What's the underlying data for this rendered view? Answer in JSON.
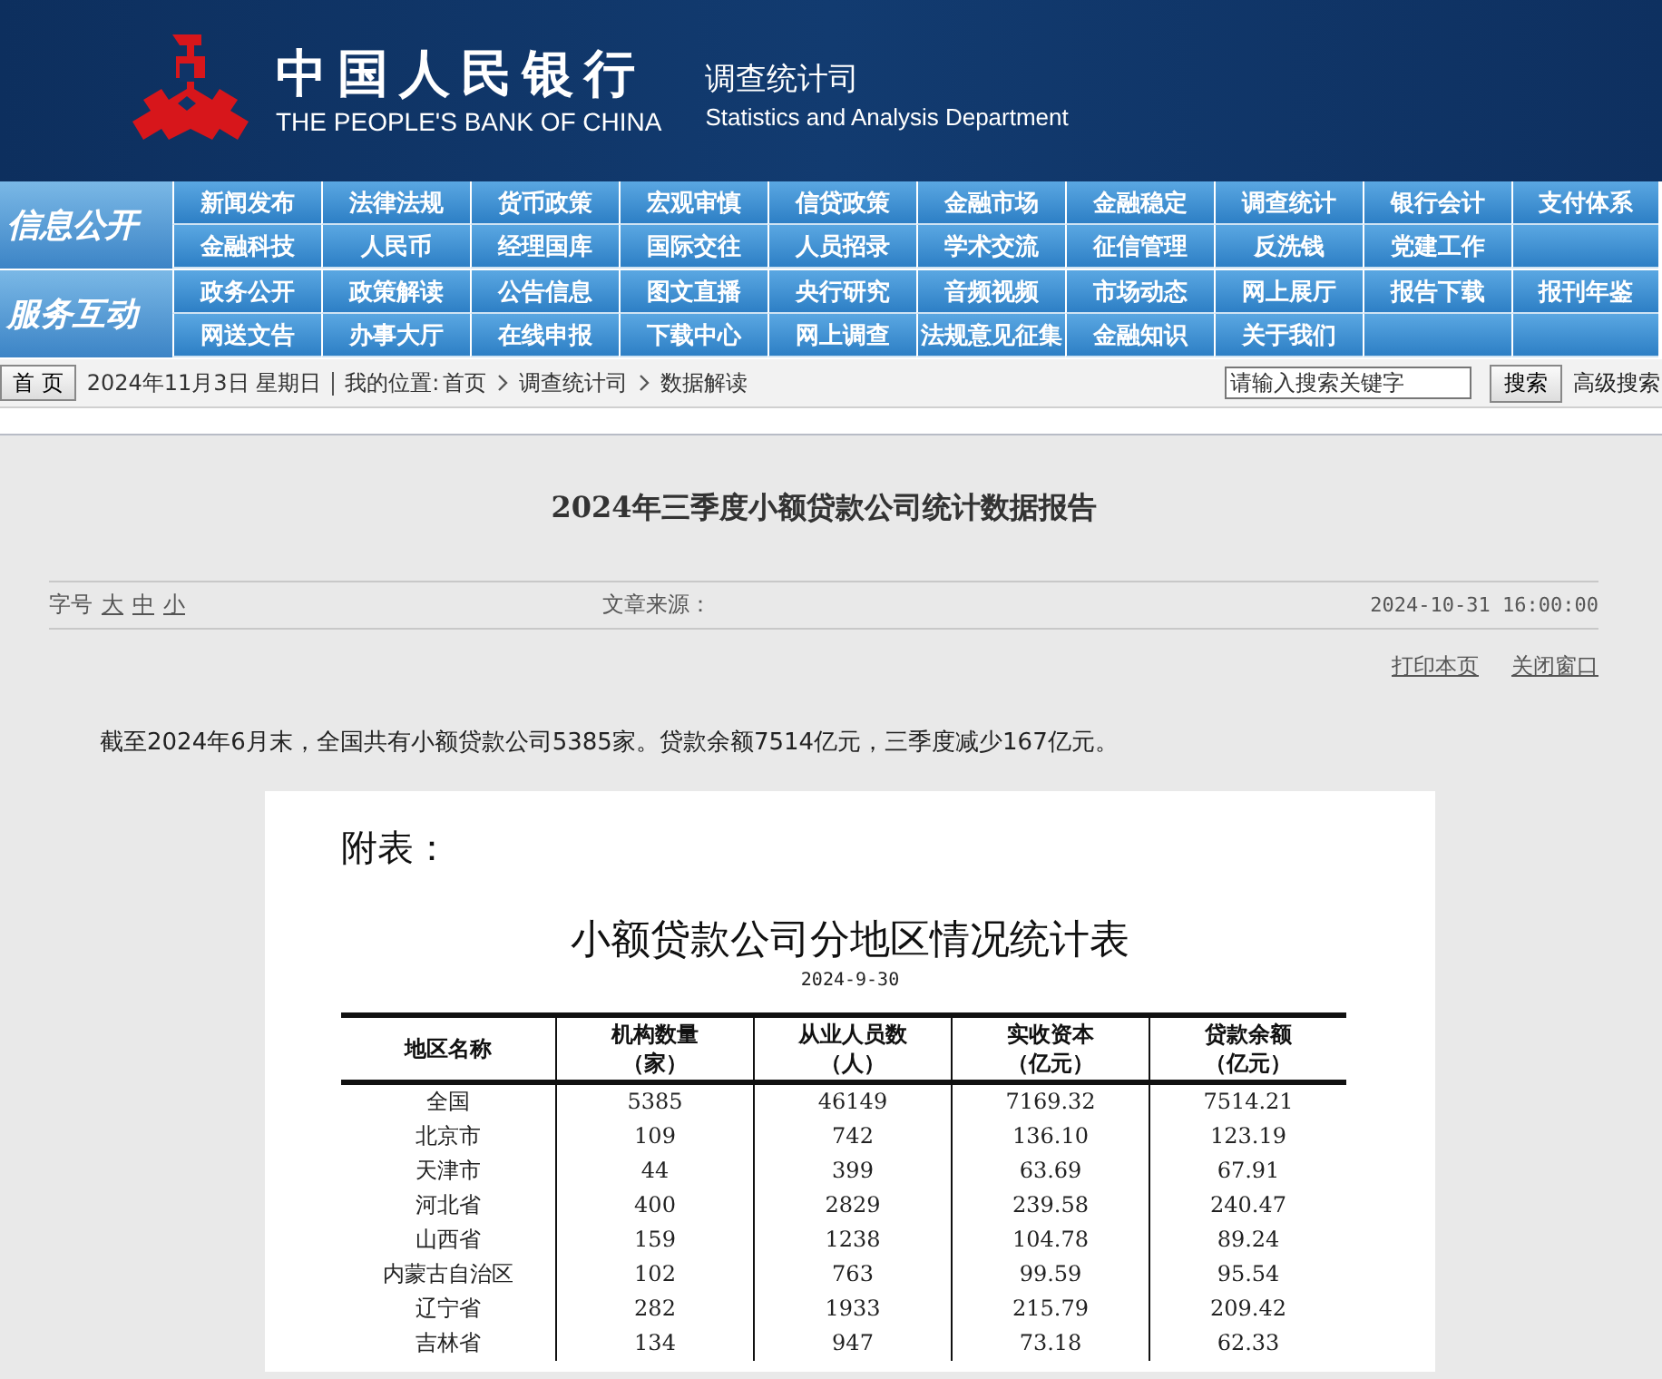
{
  "header": {
    "logo_title": "中国人民银行",
    "logo_subtitle": "THE PEOPLE'S BANK OF CHINA",
    "dept_title": "调查统计司",
    "dept_subtitle": "Statistics and Analysis Department"
  },
  "nav_groups": [
    {
      "label": "信息公开",
      "rows": [
        [
          "新闻发布",
          "法律法规",
          "货币政策",
          "宏观审慎",
          "信贷政策",
          "金融市场",
          "金融稳定",
          "调查统计",
          "银行会计",
          "支付体系"
        ],
        [
          "金融科技",
          "人民币",
          "经理国库",
          "国际交往",
          "人员招录",
          "学术交流",
          "征信管理",
          "反洗钱",
          "党建工作"
        ]
      ]
    },
    {
      "label": "服务互动",
      "rows": [
        [
          "政务公开",
          "政策解读",
          "公告信息",
          "图文直播",
          "央行研究",
          "音频视频",
          "市场动态",
          "网上展厅",
          "报告下载",
          "报刊年鉴"
        ],
        [
          "网送文告",
          "办事大厅",
          "在线申报",
          "下载中心",
          "网上调查",
          "法规意见征集",
          "金融知识",
          "关于我们"
        ]
      ]
    }
  ],
  "breadcrumb": {
    "home_button": "首 页",
    "date": "2024年11月3日  星期日",
    "location_label": "我的位置:",
    "items": [
      "首页",
      "调查统计司",
      "数据解读"
    ],
    "search": {
      "placeholder": "请输入搜索关键字"
    },
    "search_button": "搜索",
    "advanced_link": "高级搜索"
  },
  "article": {
    "title": "2024年三季度小额贷款公司统计数据报告",
    "font_size_label": "字号",
    "font_sizes": [
      "大",
      "中",
      "小"
    ],
    "source": "文章来源：",
    "datetime": "2024-10-31 16:00:00",
    "actions": [
      "打印本页",
      "关闭窗口"
    ],
    "paragraph": "截至2024年6月末，全国共有小额贷款公司5385家。贷款余额7514亿元，三季度减少167亿元。"
  },
  "attachment": {
    "label": "附表：",
    "title": "小额贷款公司分地区情况统计表",
    "date": "2024-9-30",
    "columns": [
      {
        "name": "地区名称"
      },
      {
        "name": "机构数量",
        "unit": "（家）"
      },
      {
        "name": "从业人员数",
        "unit": "（人）"
      },
      {
        "name": "实收资本",
        "unit": "（亿元）"
      },
      {
        "name": "贷款余额",
        "unit": "（亿元）"
      }
    ],
    "rows": [
      [
        "全国",
        "5385",
        "46149",
        "7169.32",
        "7514.21"
      ],
      [
        "北京市",
        "109",
        "742",
        "136.10",
        "123.19"
      ],
      [
        "天津市",
        "44",
        "399",
        "63.69",
        "67.91"
      ],
      [
        "河北省",
        "400",
        "2829",
        "239.58",
        "240.47"
      ],
      [
        "山西省",
        "159",
        "1238",
        "104.78",
        "89.24"
      ],
      [
        "内蒙古自治区",
        "102",
        "763",
        "99.59",
        "95.54"
      ],
      [
        "辽宁省",
        "282",
        "1933",
        "215.79",
        "209.42"
      ],
      [
        "吉林省",
        "134",
        "947",
        "73.18",
        "62.33"
      ]
    ]
  }
}
